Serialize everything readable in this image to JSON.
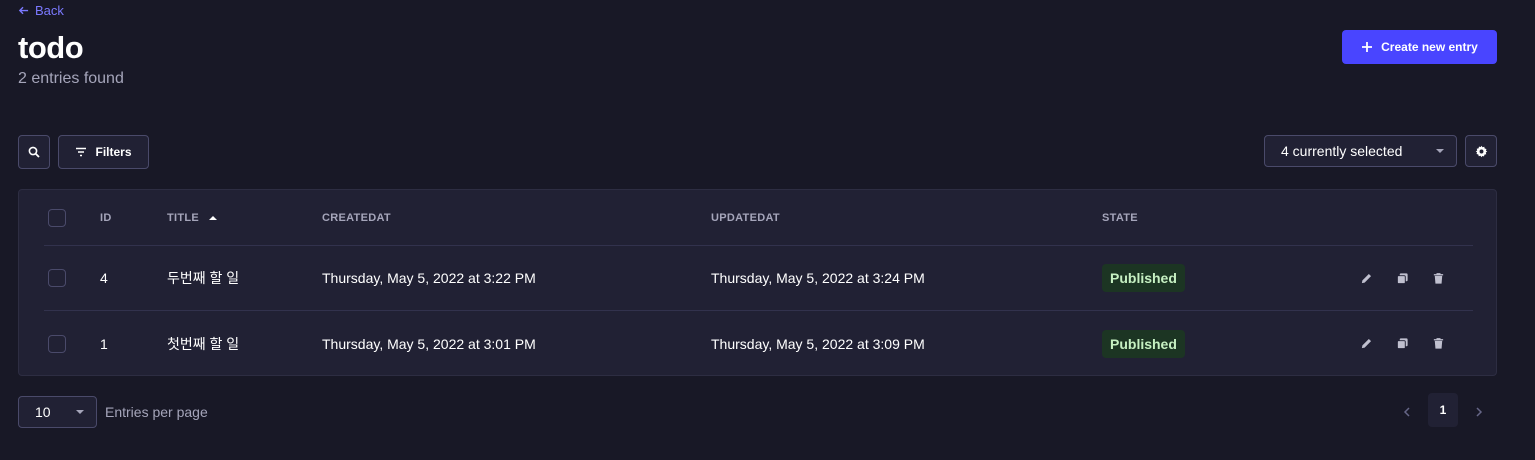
{
  "header": {
    "back_label": "Back",
    "title": "todo",
    "subtitle": "2 entries found",
    "create_label": "Create new entry"
  },
  "toolbar": {
    "filters_label": "Filters",
    "columns_selected": "4 currently selected"
  },
  "table": {
    "headers": {
      "id": "ID",
      "title": "TITLE",
      "createdat": "CREATEDAT",
      "updatedat": "UPDATEDAT",
      "state": "STATE"
    },
    "rows": [
      {
        "id": "4",
        "title": "두번째 할 일",
        "createdat": "Thursday, May 5, 2022 at 3:22 PM",
        "updatedat": "Thursday, May 5, 2022 at 3:24 PM",
        "state": "Published"
      },
      {
        "id": "1",
        "title": "첫번째 할 일",
        "createdat": "Thursday, May 5, 2022 at 3:01 PM",
        "updatedat": "Thursday, May 5, 2022 at 3:09 PM",
        "state": "Published"
      }
    ]
  },
  "footer": {
    "per_page_value": "10",
    "per_page_label": "Entries per page",
    "current_page": "1"
  },
  "icons": {
    "back": "arrow-left-icon",
    "create": "plus-icon",
    "search": "search-icon",
    "filters": "filter-icon",
    "settings": "gear-icon",
    "edit": "pencil-icon",
    "duplicate": "duplicate-icon",
    "delete": "trash-icon"
  },
  "colors": {
    "background": "#181826",
    "surface": "#212134",
    "accent": "#4945ff",
    "link": "#7b79ff",
    "published_bg": "#1c3523",
    "published_text": "#c6f0c2"
  }
}
